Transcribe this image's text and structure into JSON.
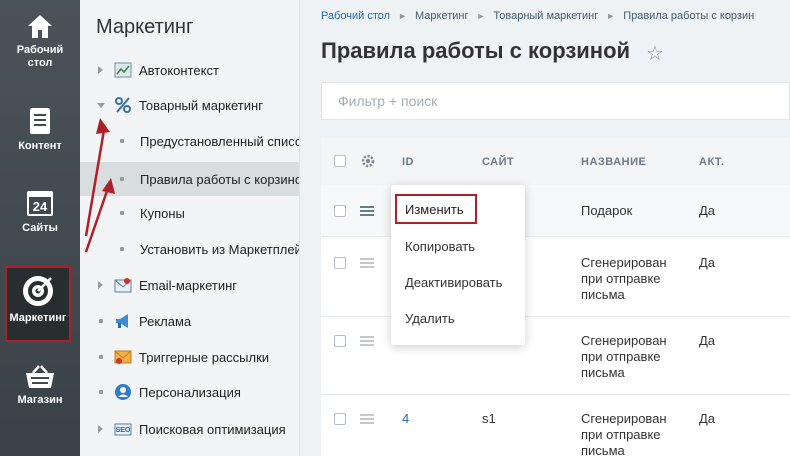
{
  "rail": {
    "items": [
      {
        "label": "Рабочий\nстол",
        "icon": "home-icon"
      },
      {
        "label": "Контент",
        "icon": "document-icon"
      },
      {
        "label": "Сайты",
        "icon": "calendar-icon"
      },
      {
        "label": "Маркетинг",
        "icon": "target-icon"
      },
      {
        "label": "Магазин",
        "icon": "basket-icon"
      }
    ],
    "labels": {
      "desktop1": "Рабочий",
      "desktop2": "стол",
      "content": "Контент",
      "sites": "Сайты",
      "sites_num": "24",
      "marketing": "Маркетинг",
      "shop": "Магазин"
    }
  },
  "menu": {
    "title": "Маркетинг",
    "items": {
      "autocontext": "Автоконтекст",
      "product_marketing": "Товарный маркетинг",
      "predefined": "Предустановленный списо",
      "cart_rules": "Правила работы с корзино",
      "coupons": "Купоны",
      "install_market": "Установить из Маркетплей",
      "email": "Email-маркетинг",
      "ads": "Реклама",
      "trigger": "Триггерные рассылки",
      "personal": "Персонализация",
      "seo": "Поисковая оптимизация"
    }
  },
  "breadcrumbs": [
    "Рабочий стол",
    "Маркетинг",
    "Товарный маркетинг",
    "Правила работы с корзин"
  ],
  "page_title": "Правила работы с корзиной",
  "filter": {
    "placeholder": "Фильтр + поиск"
  },
  "grid": {
    "headers": {
      "id": "ID",
      "site": "САЙТ",
      "name": "НАЗВАНИЕ",
      "active": "АКТ."
    },
    "rows": [
      {
        "id": "",
        "site": "",
        "name": "Подарок",
        "active": "Да"
      },
      {
        "id": "",
        "site": "",
        "name1": "Сгенерирован",
        "name2": "при отправке",
        "name3": "письма",
        "active": "Да"
      },
      {
        "id": "",
        "site": "",
        "name1": "Сгенерирован",
        "name2": "при отправке",
        "name3": "письма",
        "active": "Да"
      },
      {
        "id": "4",
        "site": "s1",
        "name1": "Сгенерирован",
        "name2": "при отправке",
        "name3": "письма",
        "active": "Да"
      }
    ]
  },
  "context_menu": {
    "edit": "Изменить",
    "copy": "Копировать",
    "deactivate": "Деактивировать",
    "delete": "Удалить"
  },
  "colors": {
    "highlight": "#b0202a",
    "link": "#2067b0",
    "rail": "#3f484d"
  }
}
